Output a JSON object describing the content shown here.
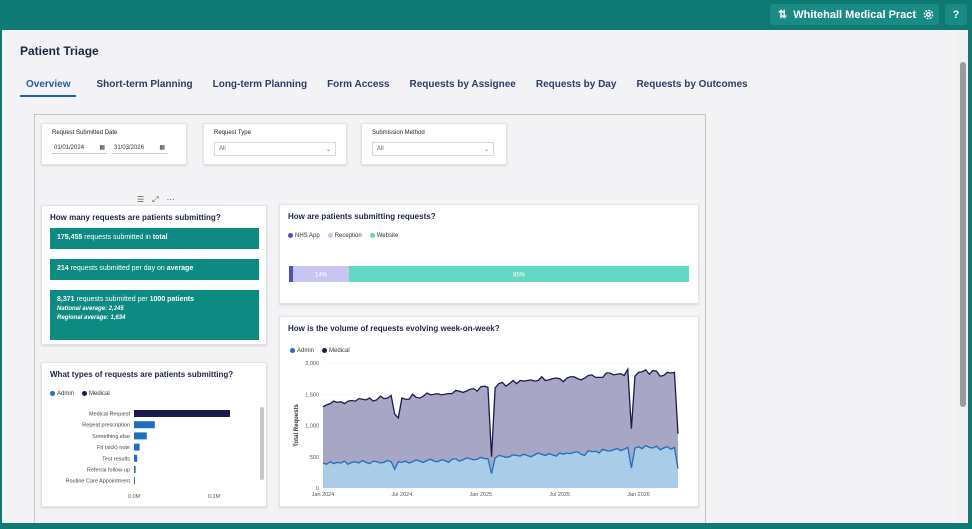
{
  "header": {
    "practice_name": "Whitehall Medical Practice",
    "settings_icon": "gear-icon",
    "help_label": "?"
  },
  "page": {
    "title": "Patient Triage",
    "tabs": [
      {
        "label": "Overview"
      },
      {
        "label": "Short-term Planning"
      },
      {
        "label": "Long-term Planning"
      },
      {
        "label": "Form Access"
      },
      {
        "label": "Requests by Assignee"
      },
      {
        "label": "Requests by Day"
      },
      {
        "label": "Requests by Outcomes"
      }
    ]
  },
  "filters": {
    "date": {
      "label": "Request Submitted Date",
      "from": "01/01/2024",
      "to": "31/03/2026"
    },
    "request_type": {
      "label": "Request Type",
      "value": "All"
    },
    "submission_method": {
      "label": "Submission Method",
      "value": "All"
    }
  },
  "kpis": {
    "title": "How many requests are patients submitting?",
    "total": {
      "value": "175,455",
      "text": "requests submitted in",
      "emph": "total"
    },
    "per_day": {
      "value": "214",
      "text": "requests submitted per day on",
      "emph": "average"
    },
    "per_1000": {
      "value": "8,371",
      "text": "requests submitted per",
      "emph": "1000 patients",
      "national": "National average: 2,245",
      "regional": "Regional average: 1,634"
    }
  },
  "colors": {
    "teal": "#0d8a82",
    "navy": "#1b1b4f",
    "blue": "#1f6fc0",
    "lavender": "#c8c6f0",
    "mint": "#64d8c0"
  },
  "method_chart": {
    "title": "How are patients submitting requests?",
    "legend": [
      "NHS App",
      "Reception",
      "Website"
    ],
    "chart_data": {
      "type": "bar",
      "stacked": true,
      "orientation": "horizontal",
      "series": [
        {
          "name": "NHS App",
          "value": 1
        },
        {
          "name": "Reception",
          "value": 14,
          "label": "14%"
        },
        {
          "name": "Website",
          "value": 85,
          "label": "85%"
        }
      ]
    }
  },
  "types_chart": {
    "title": "What types of requests are patients submitting?",
    "legend": [
      "Admin",
      "Medical"
    ],
    "chart_data": {
      "type": "bar",
      "orientation": "horizontal",
      "categories": [
        "Medical Request",
        "Repeat prescription",
        "Something else",
        "Fit (sick) note",
        "Test results",
        "Referral follow-up",
        "Routine Care Appointment"
      ],
      "values": [
        0.12,
        0.026,
        0.016,
        0.007,
        0.004,
        0.002,
        0.001
      ],
      "xticks": [
        "0.0M",
        "0.1M"
      ],
      "xlim": [
        0,
        0.13
      ]
    }
  },
  "volume_chart": {
    "title": "How is the volume of requests evolving week-on-week?",
    "legend": [
      "Admin",
      "Medical"
    ],
    "ylabel": "Total Requests",
    "yticks": [
      "0",
      "500",
      "1,000",
      "1,500",
      "2,000"
    ],
    "xticks": [
      "Jan 2024",
      "Jul 2024",
      "Jan 2025",
      "Jul 2025",
      "Jan 2026"
    ],
    "chart_data": {
      "type": "area",
      "stacked": true,
      "x_start": "Jan 2024",
      "x_interval": "week",
      "ylim": [
        0,
        2000
      ],
      "series": [
        {
          "name": "Admin",
          "values": [
            400,
            380,
            420,
            390,
            410,
            400,
            430,
            380,
            410,
            420,
            400,
            440,
            410,
            390,
            430,
            420,
            400,
            410,
            440,
            420,
            300,
            420,
            410,
            430,
            400,
            420,
            450,
            430,
            410,
            440,
            460,
            430,
            420,
            450,
            440,
            410,
            460,
            470,
            430,
            450,
            480,
            470,
            450,
            460,
            490,
            470,
            470,
            230,
            480,
            520,
            510,
            490,
            500,
            530,
            520,
            510,
            540,
            520,
            500,
            530,
            560,
            540,
            520,
            550,
            530,
            510,
            560,
            540,
            560,
            550,
            570,
            580,
            540,
            520,
            600,
            580,
            590,
            560,
            620,
            600,
            590,
            610,
            630,
            600,
            620,
            650,
            320,
            640,
            660,
            630,
            680,
            650,
            640,
            670,
            610,
            640,
            660,
            620,
            650,
            310
          ]
        },
        {
          "name": "Medical",
          "values": [
            900,
            950,
            930,
            1000,
            960,
            980,
            920,
            1010,
            990,
            970,
            1030,
            980,
            1000,
            1050,
            960,
            990,
            1070,
            1020,
            1000,
            1060,
            880,
            700,
            1030,
            990,
            1020,
            1080,
            1000,
            1010,
            1060,
            1080,
            1030,
            1070,
            1090,
            1040,
            1060,
            1100,
            1050,
            1090,
            1120,
            1080,
            1070,
            1110,
            1140,
            1090,
            1130,
            1160,
            1140,
            270,
            1120,
            1150,
            1180,
            1140,
            1170,
            1190,
            1150,
            1210,
            1170,
            1200,
            1230,
            1180,
            1160,
            1240,
            1200,
            1180,
            1220,
            1250,
            1190,
            1160,
            1200,
            1230,
            1210,
            1170,
            1190,
            1240,
            1200,
            1230,
            1180,
            1210,
            1150,
            1240,
            1250,
            1200,
            1190,
            1230,
            1180,
            1250,
            630,
            1150,
            1190,
            1230,
            1210,
            1170,
            1240,
            1200,
            1180,
            1160,
            1190,
            1220,
            1200,
            560
          ]
        }
      ]
    }
  }
}
